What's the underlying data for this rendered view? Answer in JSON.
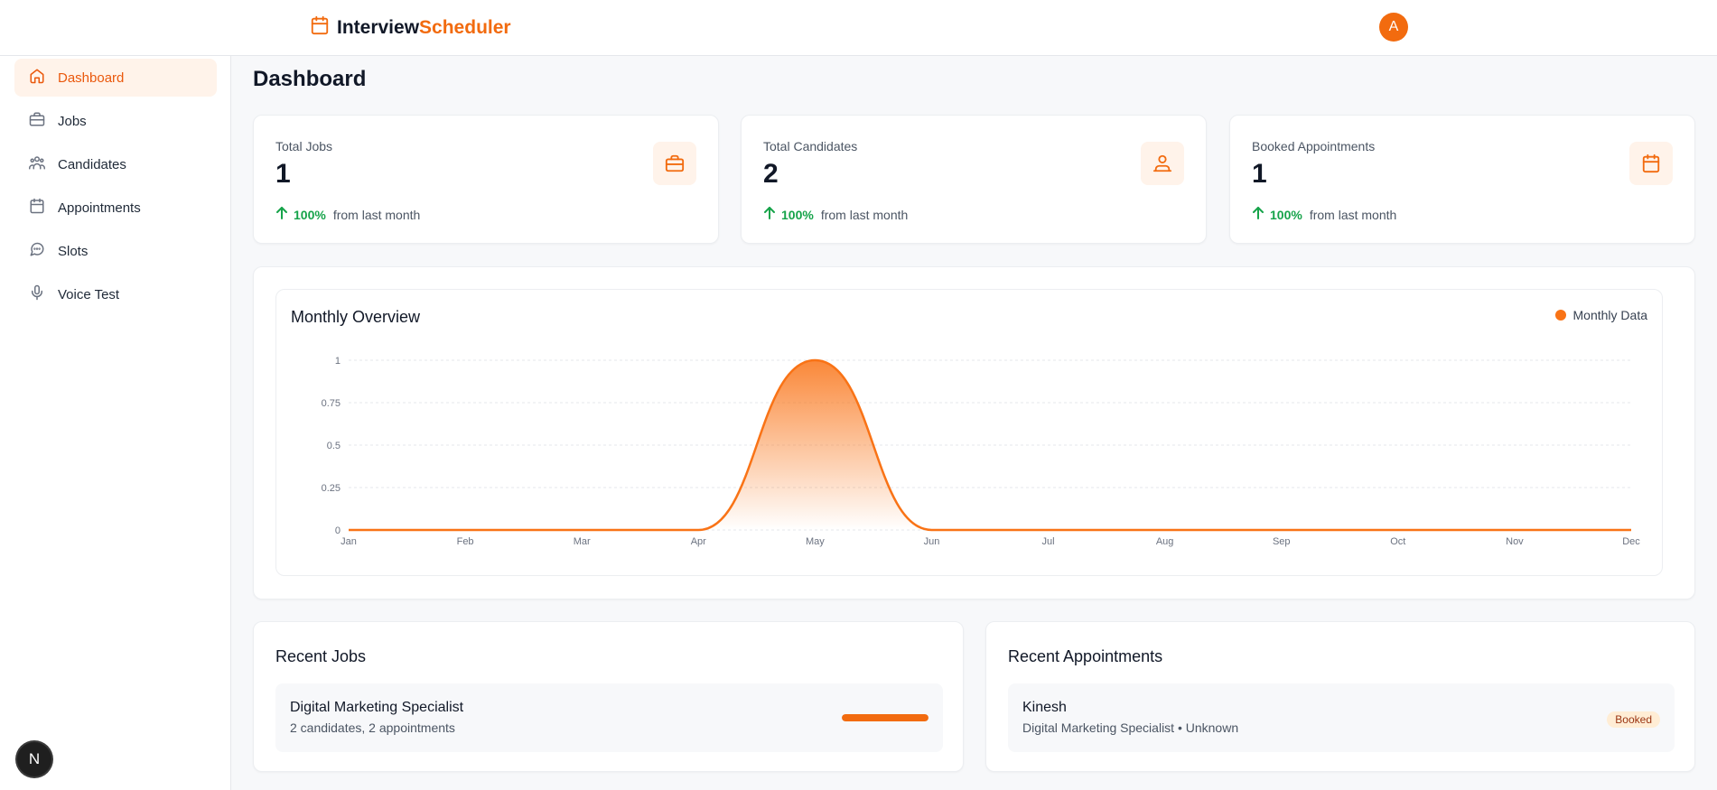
{
  "brand": {
    "part1": "Interview",
    "part2": "Scheduler"
  },
  "user": {
    "avatar_initial": "A"
  },
  "sidebar": {
    "items": [
      {
        "label": "Dashboard",
        "icon": "home-icon"
      },
      {
        "label": "Jobs",
        "icon": "briefcase-icon"
      },
      {
        "label": "Candidates",
        "icon": "users-icon"
      },
      {
        "label": "Appointments",
        "icon": "calendar-icon"
      },
      {
        "label": "Slots",
        "icon": "message-circle-icon"
      },
      {
        "label": "Voice Test",
        "icon": "microphone-icon"
      }
    ]
  },
  "devtools": {
    "label": "N"
  },
  "page": {
    "title": "Dashboard"
  },
  "stats": [
    {
      "label": "Total Jobs",
      "value": "1",
      "change": "100%",
      "change_text": "from last month",
      "icon": "briefcase-icon"
    },
    {
      "label": "Total Candidates",
      "value": "2",
      "change": "100%",
      "change_text": "from last month",
      "icon": "user-group-icon"
    },
    {
      "label": "Booked Appointments",
      "value": "1",
      "change": "100%",
      "change_text": "from last month",
      "icon": "calendar-icon"
    }
  ],
  "chart": {
    "title": "Monthly Overview",
    "legend": "Monthly Data"
  },
  "chart_data": {
    "type": "area",
    "x": [
      "Jan",
      "Feb",
      "Mar",
      "Apr",
      "May",
      "Jun",
      "Jul",
      "Aug",
      "Sep",
      "Oct",
      "Nov",
      "Dec"
    ],
    "series": [
      {
        "name": "Monthly Data",
        "values": [
          0,
          0,
          0,
          0,
          1,
          0,
          0,
          0,
          0,
          0,
          0,
          0
        ]
      }
    ],
    "yticks": [
      "0",
      "0.25",
      "0.5",
      "0.75",
      "1"
    ],
    "ylim": [
      0,
      1
    ],
    "grid": true,
    "legend_position": "top-right",
    "color": "#f97316"
  },
  "recent_jobs": {
    "title": "Recent Jobs",
    "items": [
      {
        "title": "Digital Marketing Specialist",
        "subtitle": "2 candidates, 2 appointments",
        "progress": 1.0
      }
    ]
  },
  "recent_appointments": {
    "title": "Recent Appointments",
    "items": [
      {
        "name": "Kinesh",
        "detail": "Digital Marketing Specialist • Unknown",
        "status": "Booked"
      }
    ]
  },
  "colors": {
    "accent": "#f26b0f",
    "positive": "#16a34a"
  }
}
